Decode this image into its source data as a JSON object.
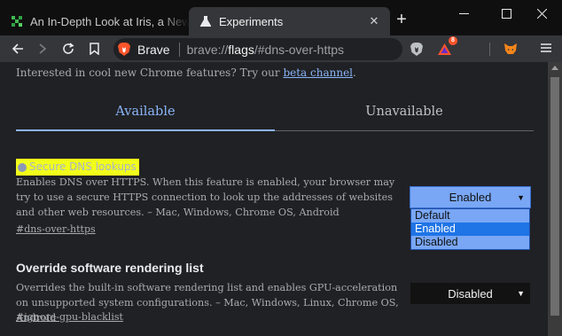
{
  "colors": {
    "tab_strip": "#0f0f10",
    "toolbar": "#35363a",
    "page_bg": "#202124",
    "accent_link": "#8ab4f8",
    "highlight": "#f2ff1b",
    "select_active_bg": "#79a7f5",
    "selected_option": "#1f74e6",
    "brave_orange": "#fb542b"
  },
  "browser": {
    "tabs": [
      {
        "title": "An In-Depth Look at Iris, a New De",
        "icon": "green-grid-favicon",
        "active": false
      },
      {
        "title": "Experiments",
        "icon": "flask-icon",
        "active": true
      }
    ],
    "window_controls": {
      "minimize": "minimize-icon",
      "maximize": "maximize-icon",
      "close": "close-icon"
    },
    "omnibox": {
      "brand_label": "Brave",
      "scheme": "brave://",
      "host": "flags",
      "path": "/#dns-over-https"
    },
    "rewards_badge_count": "8"
  },
  "page": {
    "intro_text": "Interested in cool new Chrome features? Try our ",
    "intro_link": "beta channel",
    "intro_period": ".",
    "tabs": {
      "available": "Available",
      "unavailable": "Unavailable"
    },
    "flags": [
      {
        "title": "Secure DNS lookups",
        "description": "Enables DNS over HTTPS. When this feature is enabled, your browser may try to use a secure HTTPS connection to look up the addresses of websites and other web resources. – Mac, Windows, Chrome OS, Android",
        "anchor": "#dns-over-https",
        "selected": "Enabled",
        "options": [
          "Default",
          "Enabled",
          "Disabled"
        ],
        "highlighted": "Enabled"
      },
      {
        "title": "Override software rendering list",
        "description": "Overrides the built-in software rendering list and enables GPU-acceleration on unsupported system configurations. – Mac, Windows, Linux, Chrome OS, Android",
        "anchor": "#ignore-gpu-blacklist",
        "selected": "Disabled"
      }
    ]
  }
}
